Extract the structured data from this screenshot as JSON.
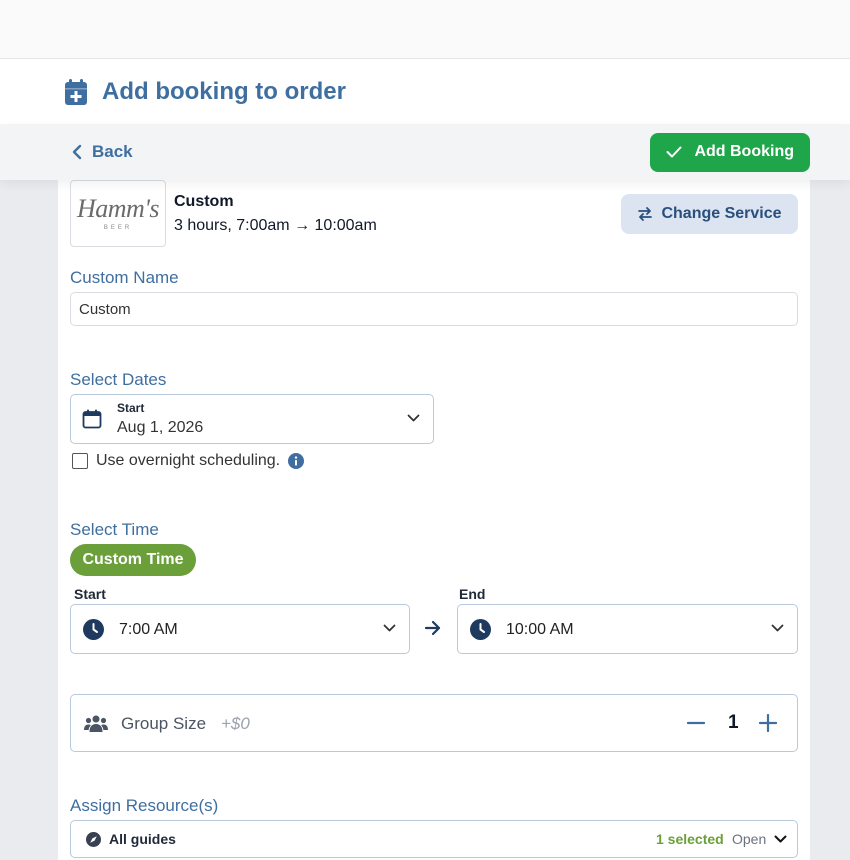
{
  "header": {
    "title": "Add booking to order",
    "back_label": "Back",
    "add_booking_label": "Add Booking"
  },
  "service": {
    "logo_text": "Hamm's",
    "logo_sub": "BEER",
    "name": "Custom",
    "description": "3 hours, 7:00am → 10:00am",
    "change_label": "Change Service"
  },
  "custom_name": {
    "label": "Custom Name",
    "value": "Custom"
  },
  "dates": {
    "label": "Select Dates",
    "start_label": "Start",
    "start_value": "Aug 1, 2026",
    "overnight_label": "Use overnight scheduling."
  },
  "time": {
    "label": "Select Time",
    "custom_time_label": "Custom Time",
    "start_label": "Start",
    "start_value": "7:00 AM",
    "end_label": "End",
    "end_value": "10:00 AM"
  },
  "group": {
    "label": "Group Size",
    "price": "+$0",
    "quantity": "1"
  },
  "resources": {
    "label": "Assign Resource(s)",
    "name": "All guides",
    "selected": "1 selected",
    "status": "Open"
  },
  "colors": {
    "primary_blue": "#3f6fa0",
    "success_green": "#1fa64a",
    "pill_green": "#6a9f3a"
  }
}
